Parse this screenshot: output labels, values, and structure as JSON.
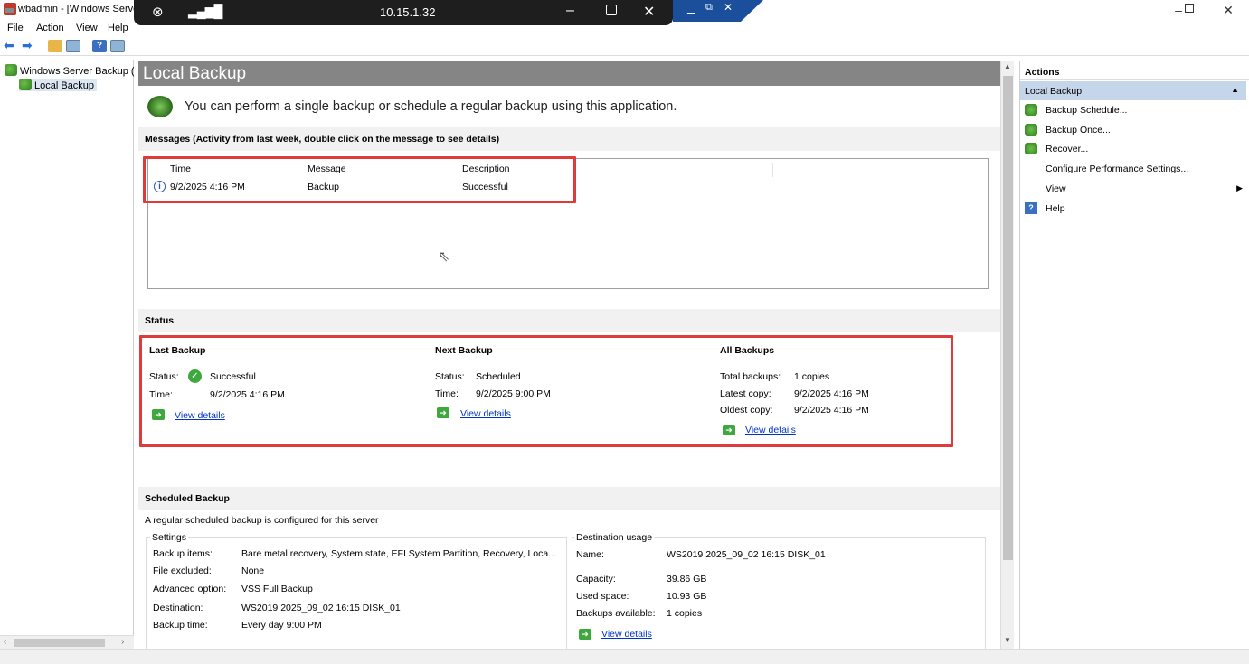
{
  "window": {
    "title": "wbadmin - [Windows Server Backup (Local)\\Local Backup]"
  },
  "rdp": {
    "ip": "10.15.1.32"
  },
  "menu": [
    "File",
    "Action",
    "View",
    "Help"
  ],
  "tree": {
    "root": "Windows Server Backup (Local)",
    "child": "Local Backup"
  },
  "main": {
    "title": "Local Backup",
    "intro": "You can perform a single backup or schedule a regular backup using this application.",
    "messages_header": "Messages (Activity from last week, double click on the message to see details)",
    "messages_columns": [
      "Time",
      "Message",
      "Description"
    ],
    "messages_rows": [
      {
        "time": "9/2/2025 4:16 PM",
        "message": "Backup",
        "description": "Successful"
      }
    ],
    "status_header": "Status",
    "last_backup": {
      "title": "Last Backup",
      "status_label": "Status:",
      "status_value": "Successful",
      "time_label": "Time:",
      "time_value": "9/2/2025 4:16 PM",
      "link": "View details"
    },
    "next_backup": {
      "title": "Next Backup",
      "status_label": "Status:",
      "status_value": "Scheduled",
      "time_label": "Time:",
      "time_value": "9/2/2025 9:00 PM",
      "link": "View details"
    },
    "all_backups": {
      "title": "All Backups",
      "total_label": "Total backups:",
      "total_value": "1 copies",
      "latest_label": "Latest copy:",
      "latest_value": "9/2/2025 4:16 PM",
      "oldest_label": "Oldest copy:",
      "oldest_value": "9/2/2025 4:16 PM",
      "link": "View details"
    },
    "scheduled_header": "Scheduled Backup",
    "scheduled_desc": "A regular scheduled backup is configured for this server",
    "settings": {
      "title": "Settings",
      "rows": [
        {
          "label": "Backup items:",
          "value": "Bare metal recovery, System state, EFI System Partition, Recovery, Loca..."
        },
        {
          "label": "File excluded:",
          "value": "None"
        },
        {
          "label": "Advanced option:",
          "value": "VSS Full Backup"
        },
        {
          "label": "Destination:",
          "value": "WS2019 2025_09_02 16:15 DISK_01"
        },
        {
          "label": "Backup time:",
          "value": "Every day 9:00 PM"
        }
      ]
    },
    "destination": {
      "title": "Destination usage",
      "rows": [
        {
          "label": "Name:",
          "value": "WS2019 2025_09_02 16:15 DISK_01"
        },
        {
          "label": "Capacity:",
          "value": "39.86 GB"
        },
        {
          "label": "Used space:",
          "value": "10.93 GB"
        },
        {
          "label": "Backups available:",
          "value": "1 copies"
        }
      ],
      "link": "View details"
    }
  },
  "actions": {
    "header": "Actions",
    "section": "Local Backup",
    "items": [
      "Backup Schedule...",
      "Backup Once...",
      "Recover...",
      "Configure Performance Settings...",
      "View",
      "Help"
    ]
  }
}
